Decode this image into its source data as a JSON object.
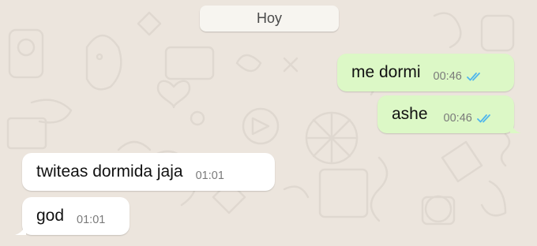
{
  "colors": {
    "wallpaper": "#ECE5DD",
    "outgoing_bubble": "#DCF8C6",
    "incoming_bubble": "#FFFFFF",
    "read_ticks": "#4FB6EC",
    "timestamp": "#7A7A7A"
  },
  "chat": {
    "day_label": "Hoy",
    "messages": [
      {
        "direction": "outgoing",
        "text": "me dormi",
        "time": "00:46",
        "status_icon": "double-check-read-icon"
      },
      {
        "direction": "outgoing",
        "text": "ashe",
        "time": "00:46",
        "status_icon": "double-check-read-icon"
      },
      {
        "direction": "incoming",
        "text": "twiteas dormida jaja",
        "time": "01:01"
      },
      {
        "direction": "incoming",
        "text": "god",
        "time": "01:01"
      }
    ]
  }
}
